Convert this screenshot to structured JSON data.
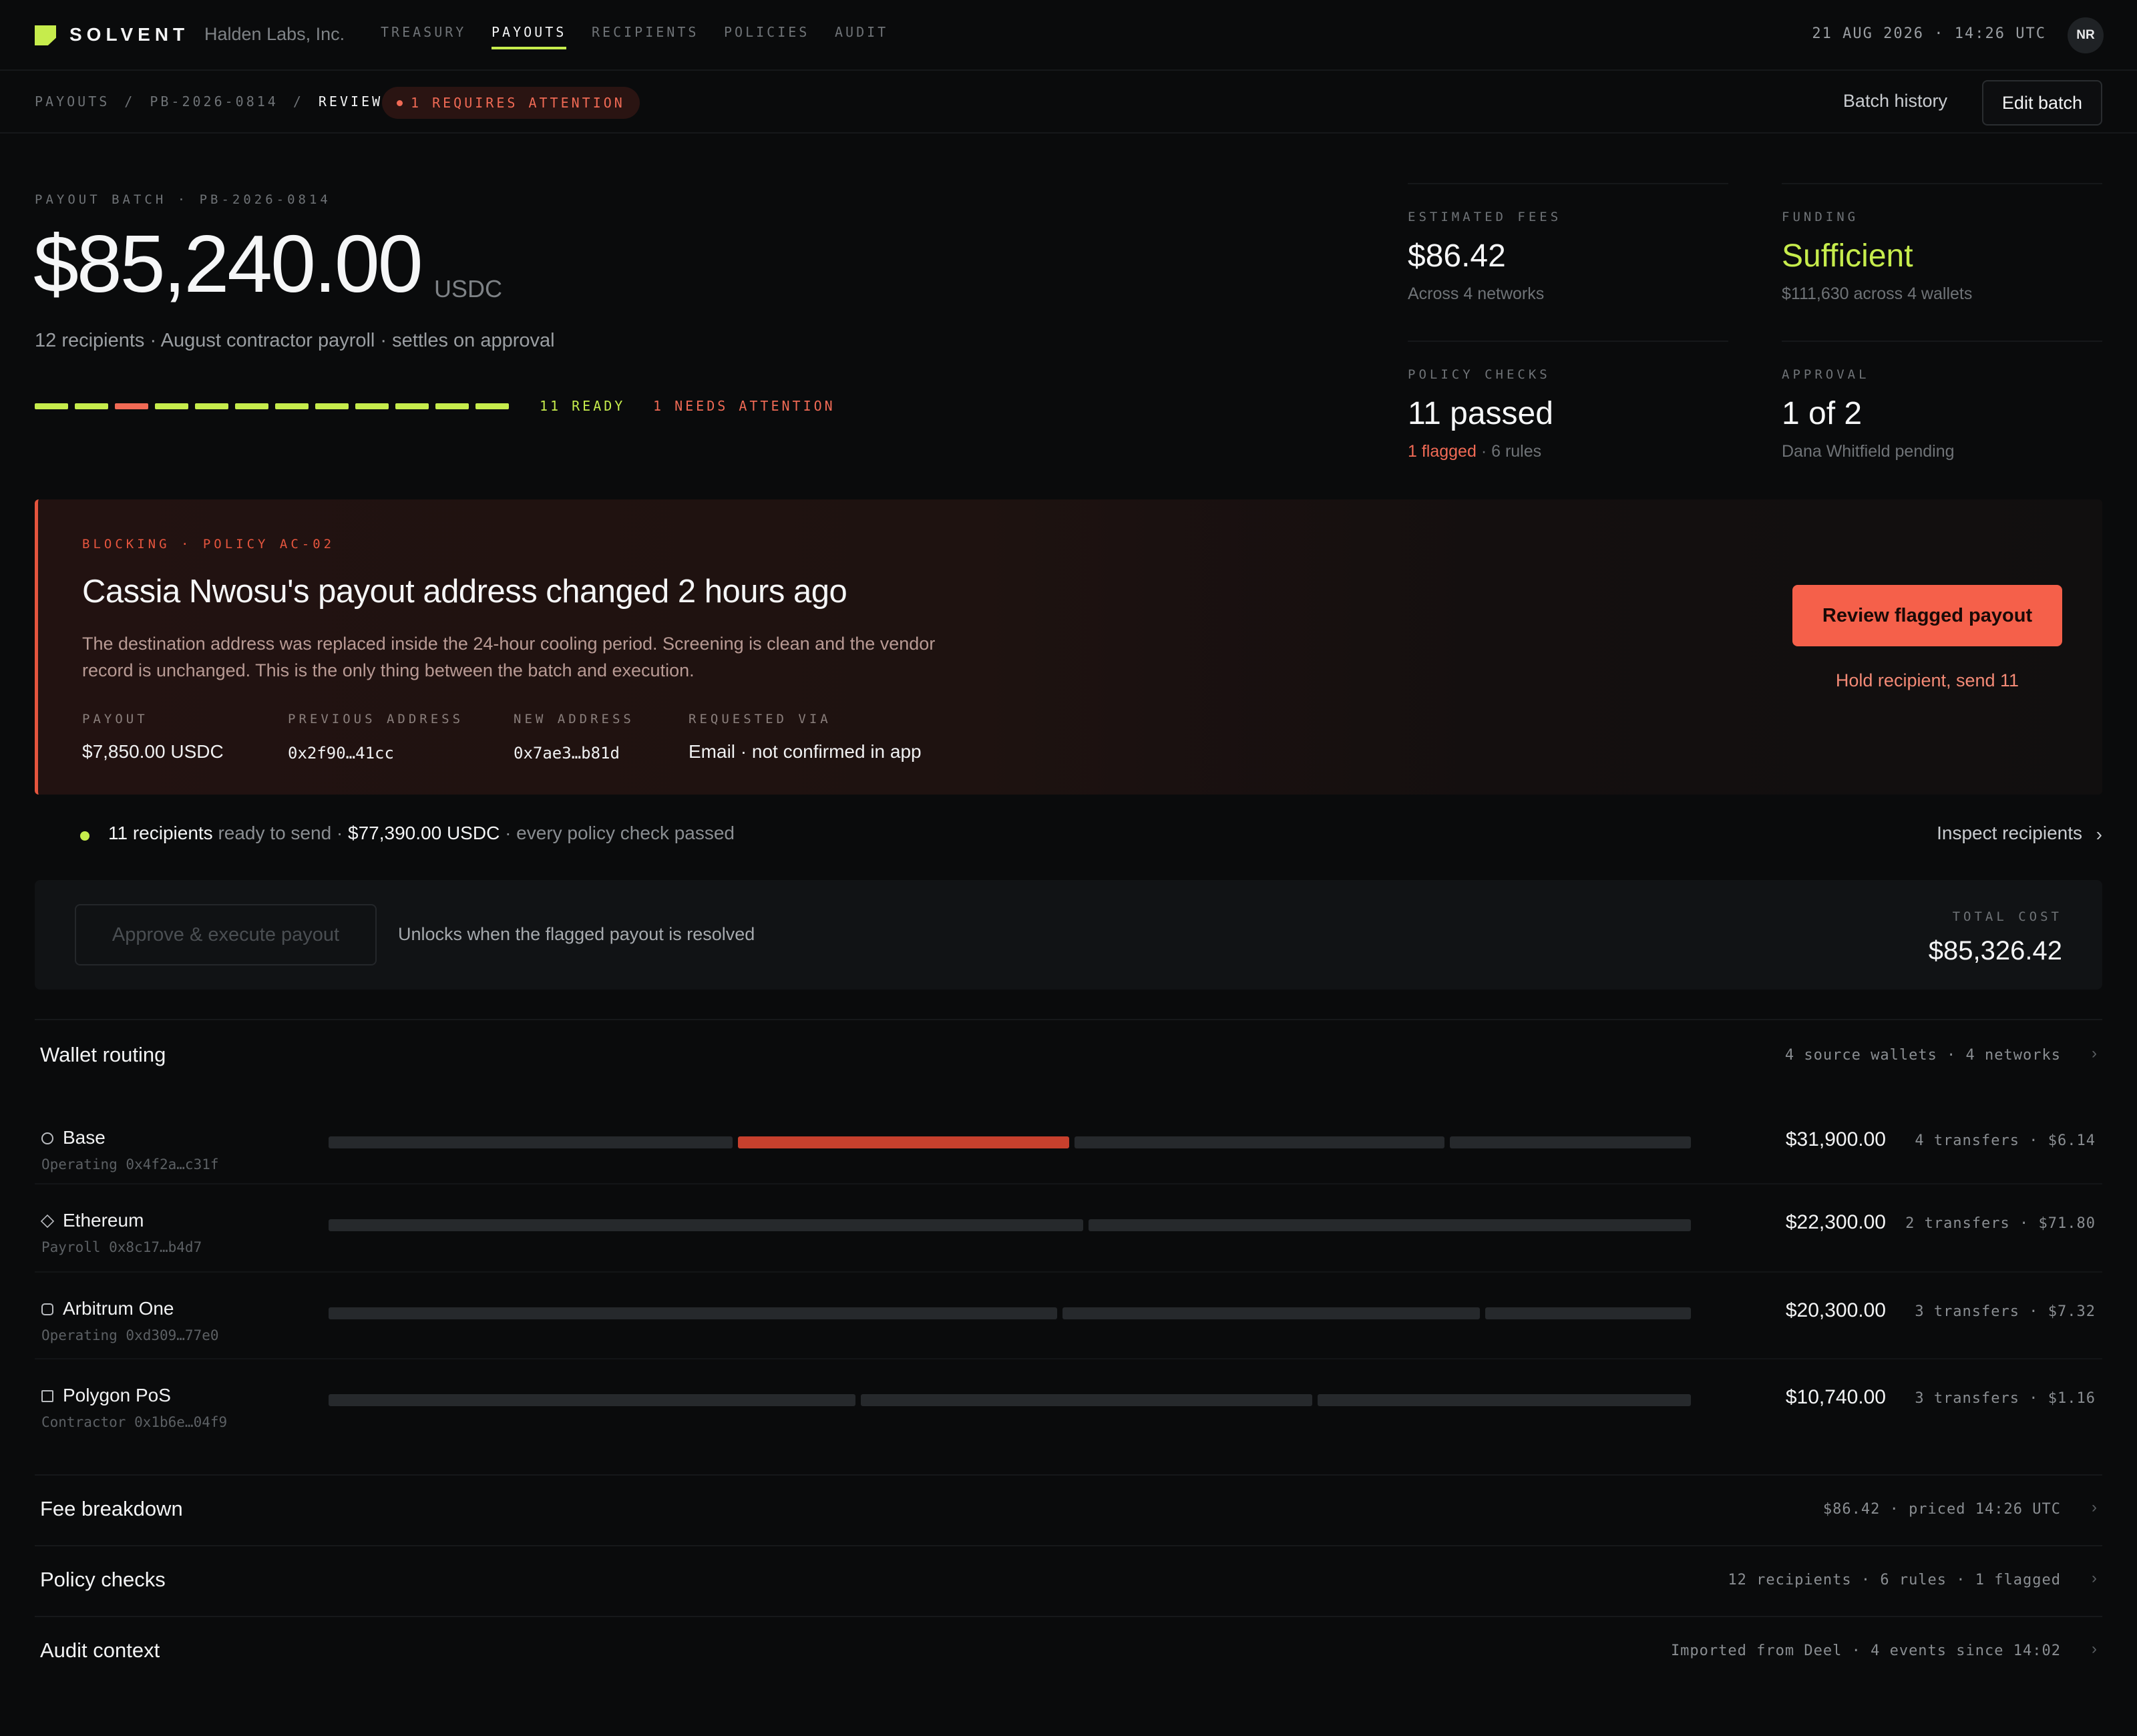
{
  "app": {
    "brand": "SOLVENT",
    "org": "Halden Labs, Inc.",
    "nav": [
      "TREASURY",
      "PAYOUTS",
      "RECIPIENTS",
      "POLICIES",
      "AUDIT"
    ],
    "active_nav": "PAYOUTS",
    "clock": "21 AUG 2026 · 14:26 UTC",
    "avatar": "NR",
    "accent_color": "#c6ec4c",
    "danger_color": "#f06a55"
  },
  "breadcrumb": {
    "items": [
      "PAYOUTS",
      "PB-2026-0814",
      "REVIEW"
    ],
    "sep": "/",
    "attention": "1 REQUIRES ATTENTION"
  },
  "actions": {
    "history": "Batch history",
    "edit": "Edit batch"
  },
  "hero": {
    "eyebrow": "PAYOUT BATCH · PB-2026-0814",
    "amount": "$85,240.00",
    "unit": "USDC",
    "subtitle": "12 recipients · August contractor payroll · settles on approval",
    "progress": {
      "total": 12,
      "flagged_index": 2
    },
    "ready_label": "11 READY",
    "attn_label": "1 NEEDS ATTENTION"
  },
  "stats": {
    "fees": {
      "label": "ESTIMATED FEES",
      "value": "$86.42",
      "sub": "Across 4 networks"
    },
    "funding": {
      "label": "FUNDING",
      "value": "Sufficient",
      "sub": "$111,630 across 4 wallets"
    },
    "policy": {
      "label": "POLICY CHECKS",
      "value": "11 passed",
      "sub_flag": "1 flagged",
      "sub_rest": " · 6 rules"
    },
    "approval": {
      "label": "APPROVAL",
      "value": "1 of 2",
      "sub": "Dana Whitfield pending"
    }
  },
  "alert": {
    "eyebrow": "BLOCKING · POLICY AC-02",
    "title": "Cassia Nwosu's payout address changed 2 hours ago",
    "desc": "The destination address was replaced inside the 24-hour cooling period. Screening is clean and the vendor record is unchanged. This is the only thing between the batch and execution.",
    "meta": [
      {
        "label": "PAYOUT",
        "value": "$7,850.00 USDC"
      },
      {
        "label": "PREVIOUS ADDRESS",
        "value": "0x2f90…41cc"
      },
      {
        "label": "NEW ADDRESS",
        "value": "0x7ae3…b81d"
      },
      {
        "label": "REQUESTED VIA",
        "value": "Email · not confirmed in app"
      }
    ],
    "primary": "Review flagged payout",
    "secondary": "Hold recipient, send 11"
  },
  "ready": {
    "count": "11 recipients",
    "mid": " ready to send · ",
    "amount": "$77,390.00 USDC",
    "tail": " · every policy check passed",
    "inspect": "Inspect recipients"
  },
  "approve": {
    "button": "Approve & execute payout",
    "hint": "Unlocks when the flagged payout is resolved",
    "total_label": "TOTAL COST",
    "total": "$85,326.42"
  },
  "routing": {
    "title": "Wallet routing",
    "meta": "4 source wallets · 4 networks",
    "wallets": [
      {
        "network": "Base",
        "wallet": "Operating 0x4f2a…c31f",
        "amount": "$31,900.00",
        "transfers": "4 transfers · $6.14",
        "icon": "circle-icon",
        "segments": [
          {
            "share": 0.3,
            "flagged": false
          },
          {
            "share": 0.246,
            "flagged": true
          },
          {
            "share": 0.275,
            "flagged": false
          },
          {
            "share": 0.179,
            "flagged": false
          }
        ]
      },
      {
        "network": "Ethereum",
        "wallet": "Payroll 0x8c17…b4d7",
        "amount": "$22,300.00",
        "transfers": "2 transfers · $71.80",
        "icon": "diamond-icon",
        "segments": [
          {
            "share": 0.556,
            "flagged": false
          },
          {
            "share": 0.444,
            "flagged": false
          }
        ]
      },
      {
        "network": "Arbitrum One",
        "wallet": "Operating 0xd309…77e0",
        "amount": "$20,300.00",
        "transfers": "3 transfers · $7.32",
        "icon": "hexagon-icon",
        "segments": [
          {
            "share": 0.539,
            "flagged": false
          },
          {
            "share": 0.309,
            "flagged": false
          },
          {
            "share": 0.152,
            "flagged": false
          }
        ]
      },
      {
        "network": "Polygon PoS",
        "wallet": "Contractor 0x1b6e…04f9",
        "amount": "$10,740.00",
        "transfers": "3 transfers · $1.16",
        "icon": "square-icon",
        "segments": [
          {
            "share": 0.39,
            "flagged": false
          },
          {
            "share": 0.334,
            "flagged": false
          },
          {
            "share": 0.276,
            "flagged": false
          }
        ]
      }
    ]
  },
  "sections": [
    {
      "title": "Fee breakdown",
      "meta": "$86.42 · priced 14:26 UTC"
    },
    {
      "title": "Policy checks",
      "meta": "12 recipients · 6 rules · 1 flagged"
    },
    {
      "title": "Audit context",
      "meta": "Imported from Deel · 4 events since 14:02"
    }
  ]
}
